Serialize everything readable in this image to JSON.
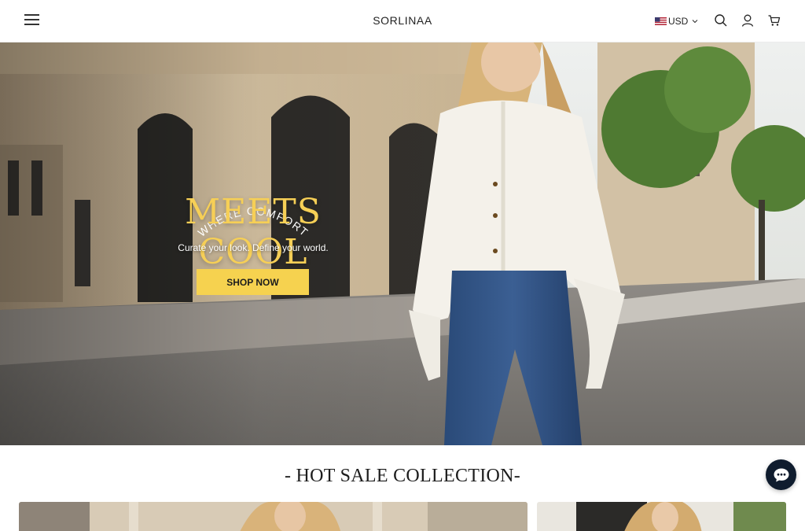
{
  "header": {
    "brand": "SORLINAA",
    "currency": "USD",
    "icons": [
      "menu-icon",
      "us-flag-icon",
      "chevron-down-icon",
      "search-icon",
      "account-icon",
      "cart-icon"
    ]
  },
  "hero": {
    "arc_text": "WHERE COMFORT",
    "title": "MEETS COOL",
    "subtitle": "Curate your look. Define your world.",
    "cta": "SHOP NOW"
  },
  "section": {
    "title": "- HOT SALE COLLECTION-"
  },
  "chat": {
    "icon": "chat-icon"
  },
  "colors": {
    "accent_yellow": "#f6d24f",
    "title_yellow": "#f6cf56",
    "chat_navy": "#0f1c2e"
  }
}
